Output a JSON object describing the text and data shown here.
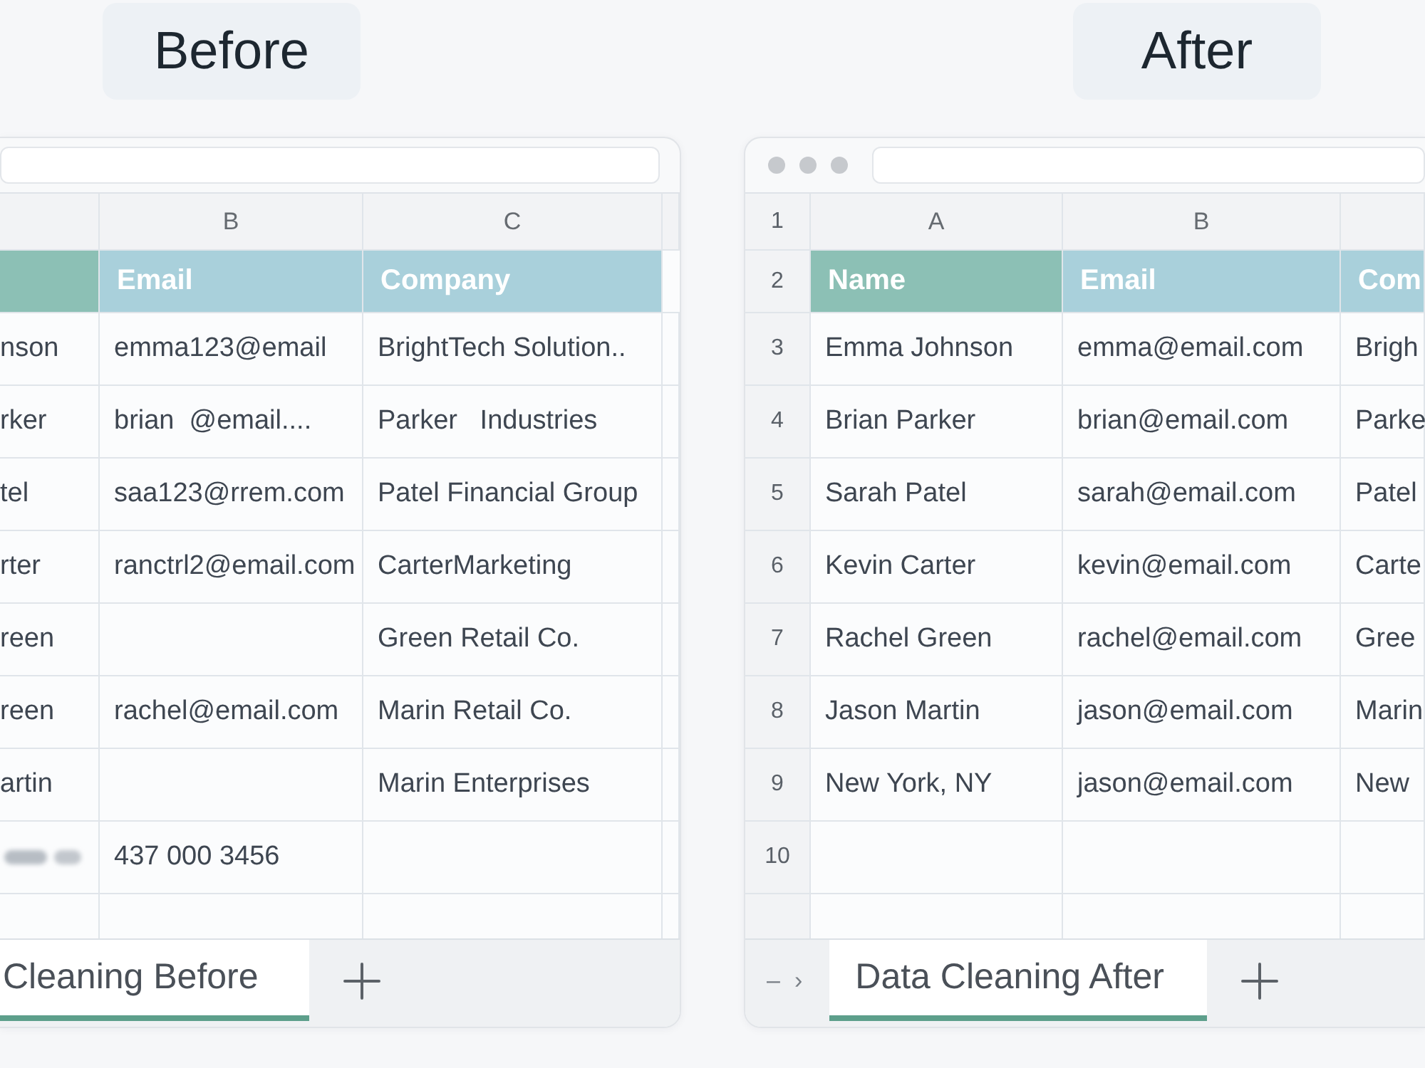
{
  "panels": [
    {
      "title": "Before",
      "letter_row": {
        "b": "B",
        "c": "C"
      },
      "header_row": {
        "b": "Email",
        "c": "Company"
      },
      "rows": [
        {
          "a": "nson",
          "b": "emma123@email",
          "c": "BrightTech Solution.."
        },
        {
          "a": "rker",
          "b": "brian  @email....",
          "c": "Parker   Industries"
        },
        {
          "a": "tel",
          "b": "saa123@rrem.com",
          "c": "Patel Financial Group"
        },
        {
          "a": "rter",
          "b": "ranctrl2@email.com",
          "c": "CarterMarketing"
        },
        {
          "a": "reen",
          "c": "Green Retail Co."
        },
        {
          "a": "reen",
          "b": "rachel@email.com",
          "c": "Marin Retail Co."
        },
        {
          "a": "artin",
          "c": "Marin Enterprises"
        },
        {
          "a_blurred": true,
          "b": "437 000 3456"
        }
      ],
      "sheet_tab": {
        "label": "Cleaning Before",
        "selected": true
      }
    },
    {
      "title": "After",
      "window_controls": true,
      "letter_row": {
        "number": "1",
        "a": "A",
        "b": "B"
      },
      "header_row": {
        "number": "2",
        "a": "Name",
        "b": "Email",
        "c": "Com"
      },
      "rows": [
        {
          "number": "3",
          "a": "Emma Johnson",
          "b": "emma@email.com",
          "c": "Brigh"
        },
        {
          "number": "4",
          "a": "Brian Parker",
          "b": "brian@email.com",
          "c": "Parke"
        },
        {
          "number": "5",
          "a": "Sarah Patel",
          "b": "sarah@email.com",
          "c": "Patel"
        },
        {
          "number": "6",
          "a": "Kevin Carter",
          "b": "kevin@email.com",
          "c": "Carte"
        },
        {
          "number": "7",
          "a": "Rachel Green",
          "b": "rachel@email.com",
          "c": "Gree"
        },
        {
          "number": "8",
          "a": "Jason Martin",
          "b": "jason@email.com",
          "c": "Marin"
        },
        {
          "number": "9",
          "a": "New York, NY",
          "b": "jason@email.com",
          "c": "New"
        },
        {
          "number": "10"
        }
      ],
      "sheet_nav": [
        "–",
        "›"
      ],
      "sheet_tab": {
        "label": "Data Cleaning After",
        "selected": true
      }
    }
  ]
}
